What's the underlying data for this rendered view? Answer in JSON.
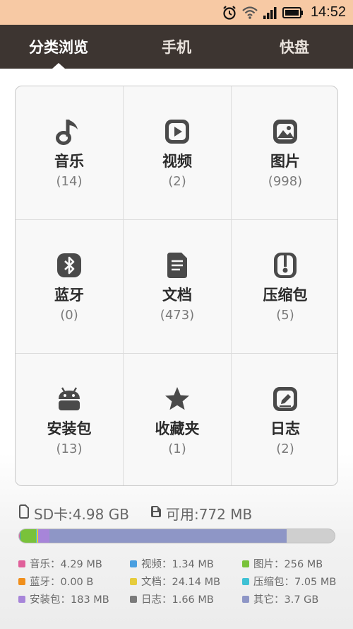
{
  "status_bar": {
    "time": "14:52",
    "icons": [
      "alarm-clock-icon",
      "wifi-icon",
      "signal-icon",
      "battery-icon"
    ]
  },
  "tabs": [
    {
      "label": "分类浏览",
      "active": true
    },
    {
      "label": "手机",
      "active": false
    },
    {
      "label": "快盘",
      "active": false
    }
  ],
  "categories": [
    {
      "label": "音乐",
      "count": "(14)",
      "icon": "music-note-icon"
    },
    {
      "label": "视频",
      "count": "(2)",
      "icon": "video-play-icon"
    },
    {
      "label": "图片",
      "count": "(998)",
      "icon": "image-icon"
    },
    {
      "label": "蓝牙",
      "count": "(0)",
      "icon": "bluetooth-icon"
    },
    {
      "label": "文档",
      "count": "(473)",
      "icon": "document-icon"
    },
    {
      "label": "压缩包",
      "count": "(5)",
      "icon": "archive-icon"
    },
    {
      "label": "安装包",
      "count": "(13)",
      "icon": "android-icon"
    },
    {
      "label": "收藏夹",
      "count": "(1)",
      "icon": "star-icon"
    },
    {
      "label": "日志",
      "count": "(2)",
      "icon": "log-edit-icon"
    }
  ],
  "storage": {
    "sd_label": "SD卡:4.98 GB",
    "available_label": "可用:772 MB"
  },
  "usage_bar": {
    "segments": [
      {
        "name": "音乐",
        "fraction": 0.003,
        "color": "#e0609a"
      },
      {
        "name": "视频",
        "fraction": 0.001,
        "color": "#4a9fe0"
      },
      {
        "name": "图片",
        "fraction": 0.05,
        "color": "#79c23a"
      },
      {
        "name": "压缩包",
        "fraction": 0.001,
        "color": "#3fc1d4"
      },
      {
        "name": "文档",
        "fraction": 0.005,
        "color": "#e6cc3c"
      },
      {
        "name": "安装包",
        "fraction": 0.036,
        "color": "#a785d9"
      },
      {
        "name": "其它",
        "fraction": 0.752,
        "color": "#8e96c6"
      }
    ],
    "free_color": "#cfcfcf"
  },
  "legend": [
    {
      "label": "音乐：4.29 MB",
      "color": "#e0609a"
    },
    {
      "label": "视频：1.34 MB",
      "color": "#4a9fe0"
    },
    {
      "label": "图片：256 MB",
      "color": "#79c23a"
    },
    {
      "label": "蓝牙：0.00 B",
      "color": "#f08f1c"
    },
    {
      "label": "文档：24.14 MB",
      "color": "#e6cc3c"
    },
    {
      "label": "压缩包：7.05 MB",
      "color": "#3fc1d4"
    },
    {
      "label": "安装包：183 MB",
      "color": "#a785d9"
    },
    {
      "label": "日志：1.66 MB",
      "color": "#7a7a7a"
    },
    {
      "label": "其它：3.7 GB",
      "color": "#8e96c6"
    }
  ]
}
